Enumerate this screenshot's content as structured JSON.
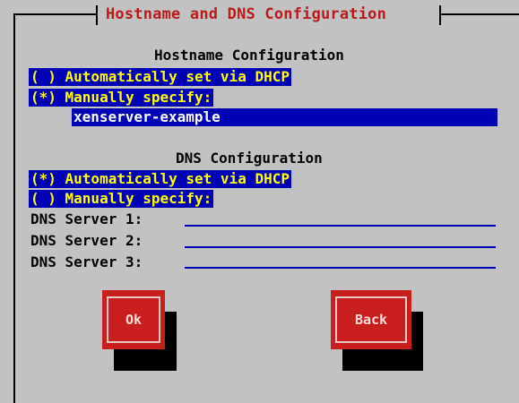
{
  "dialog": {
    "title": "Hostname and DNS Configuration"
  },
  "hostname": {
    "heading": "Hostname Configuration",
    "option_dhcp": "( ) Automatically set via DHCP",
    "option_manual": "(*) Manually specify:",
    "value": "xenserver-example"
  },
  "dns": {
    "heading": "DNS Configuration",
    "option_dhcp": "(*) Automatically set via DHCP",
    "option_manual": "( ) Manually specify:",
    "servers": [
      {
        "label": "DNS Server 1:",
        "value": ""
      },
      {
        "label": "DNS Server 2:",
        "value": ""
      },
      {
        "label": "DNS Server 3:",
        "value": ""
      }
    ]
  },
  "buttons": {
    "ok": "Ok",
    "back": "Back"
  },
  "colors": {
    "background": "#c2c2c2",
    "selection": "#0000b4",
    "selection_text": "#ffff00",
    "title": "#b81b1b",
    "button": "#c81e1e"
  }
}
